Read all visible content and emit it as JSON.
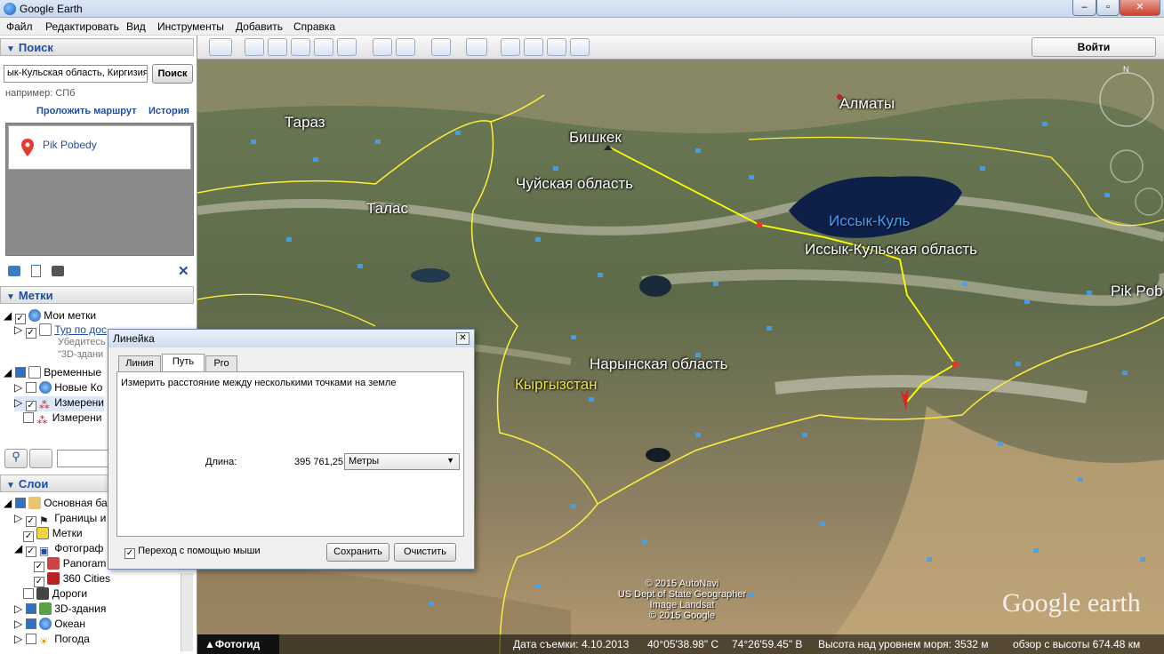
{
  "window": {
    "title": "Google Earth"
  },
  "menu": [
    "Файл",
    "Редактировать",
    "Вид",
    "Инструменты",
    "Добавить",
    "Справка"
  ],
  "search": {
    "header": "Поиск",
    "query": "ык-Кульская область, Киргизия",
    "button": "Поиск",
    "hint": "например: СПб",
    "route_link": "Проложить маршрут",
    "history_link": "История",
    "result": "Pik Pobedy"
  },
  "places": {
    "header": "Метки",
    "items": [
      "Мои метки",
      "Тур по дос",
      "Убедитесь",
      "\"3D-здани",
      "Временные",
      "Новые Ко",
      "Измерени",
      "Измерени"
    ]
  },
  "layers": {
    "header": "Слои",
    "items": [
      "Основная ба",
      "Границы и",
      "Метки",
      "Фотограф",
      "Panoram",
      "360 Cities",
      "Дороги",
      "3D-здания",
      "Океан",
      "Погода"
    ]
  },
  "toolbar": {
    "login": "Войти"
  },
  "map": {
    "labels": [
      "Тараз",
      "Алматы",
      "Бишкек",
      "Чуйская область",
      "Талас",
      "Иссык-Куль",
      "Иссык-Кульская область",
      "Pik Pob",
      "Нарынская область",
      "Кыргызстан"
    ],
    "credits": [
      "© 2015 AutoNavi",
      "US Dept of State Geographer",
      "Image Landsat",
      "© 2015 Google"
    ],
    "logo": "Google earth",
    "phototour": "Фотогид"
  },
  "status": {
    "date": "Дата съемки: 4.10.2013",
    "lat": "40°05'38.98\" С",
    "lon": "74°26'59.45\" В",
    "elev": "Высота над уровнем моря:  3532 м",
    "view": "обзор с высоты 674.48 км"
  },
  "ruler": {
    "title": "Линейка",
    "tabs": [
      "Линия",
      "Путь",
      "Pro"
    ],
    "description": "Измерить расстояние между несколькими точками на земле",
    "length_label": "Длина:",
    "length_value": "395 761,25",
    "unit": "Метры",
    "mouse_nav": "Переход с помощью мыши",
    "save": "Сохранить",
    "clear": "Очистить"
  },
  "colors": {
    "path": "#ffff00",
    "accent": "#1f4ea1"
  }
}
